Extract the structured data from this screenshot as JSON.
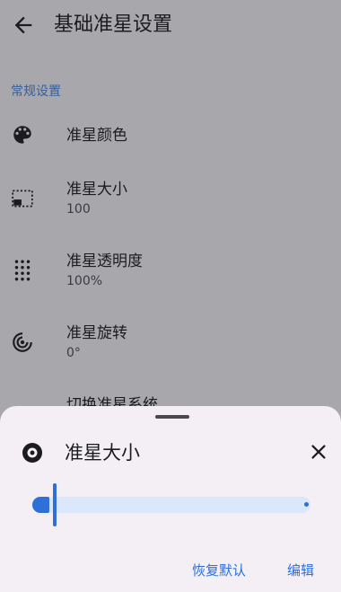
{
  "app_bar": {
    "title": "基础准星设置",
    "back_icon": "arrow-back-icon"
  },
  "section": {
    "label": "常规设置"
  },
  "settings": [
    {
      "label": "准星颜色",
      "sub": "",
      "icon": "palette-icon"
    },
    {
      "label": "准星大小",
      "sub": "100",
      "icon": "size-frame-icon"
    },
    {
      "label": "准星透明度",
      "sub": "100%",
      "icon": "dots-grid-icon"
    },
    {
      "label": "准星旋转",
      "sub": "0°",
      "icon": "rotate-icon"
    },
    {
      "label": "切换准星系统",
      "sub": "",
      "icon": ""
    }
  ],
  "sheet": {
    "title": "准星大小",
    "icon": "target-icon",
    "close_icon": "close-icon",
    "slider": {
      "value": 100,
      "fill_fraction": 0.08
    },
    "reset_label": "恢复默认",
    "edit_label": "编辑"
  },
  "colors": {
    "accent": "#2e6fd8",
    "scrim": "#a8a7ac",
    "sheet": "#f3eff5",
    "section": "#365f9c"
  }
}
